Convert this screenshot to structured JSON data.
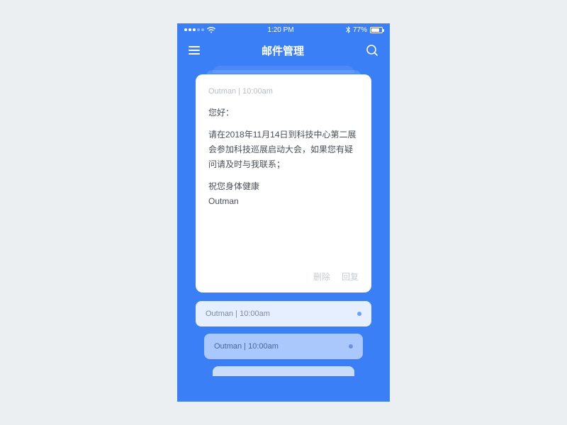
{
  "statusbar": {
    "time": "1:20 PM",
    "battery": "77%"
  },
  "navbar": {
    "title": "邮件管理"
  },
  "card": {
    "meta": "Outman | 10:00am",
    "greeting": "您好：",
    "body": "请在2018年11月14日到科技中心第二展会参加科技巡展启动大会，如果您有疑问请及时与我联系；",
    "closing": "祝您身体健康",
    "signature": "Outman",
    "delete_label": "删除",
    "reply_label": "回复"
  },
  "list": {
    "items": [
      {
        "meta": "Outman | 10:00am"
      },
      {
        "meta": "Outman | 10:00am"
      }
    ]
  }
}
